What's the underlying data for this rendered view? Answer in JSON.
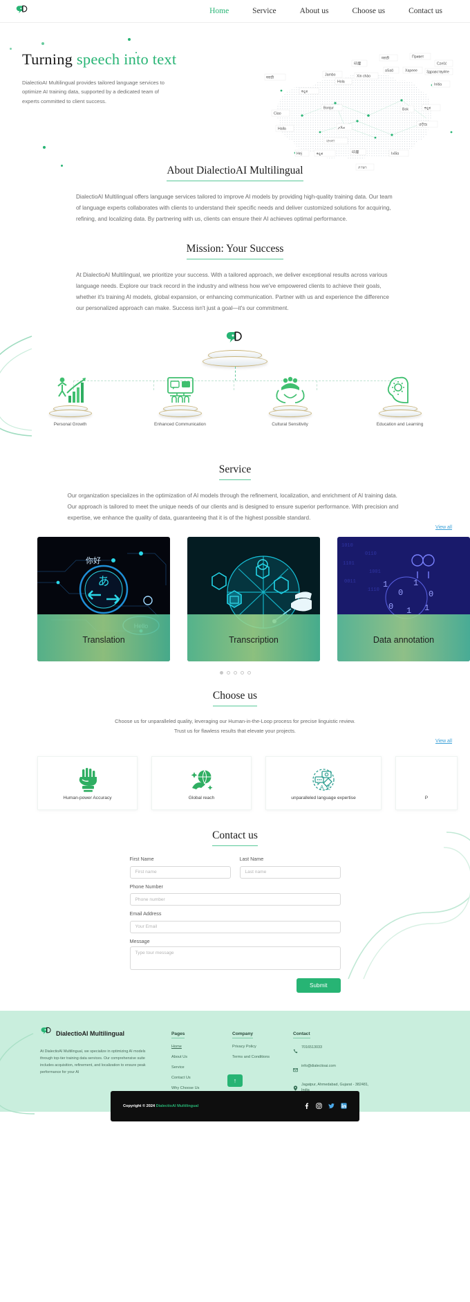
{
  "nav": {
    "brand": "DialectioAI",
    "links": [
      {
        "label": "Home",
        "active": true
      },
      {
        "label": "Service",
        "active": false
      },
      {
        "label": "About us",
        "active": false
      },
      {
        "label": "Choose us",
        "active": false
      },
      {
        "label": "Contact us",
        "active": false
      }
    ]
  },
  "hero": {
    "title_lead": "Turning ",
    "title_accent": "speech into text",
    "paragraph": "DialectioAI Multilingual provides tailored language services to optimize AI training data, supported by a dedicated team of experts committed to client success.",
    "map_labels": [
      "Привет",
      "Czeŝć",
      "Здравствуйте",
      "印度",
      "नमस्ते",
      "Hola",
      "aSaŭ",
      "Хареее",
      "Xin chào",
      "Jambo",
      "Initia",
      "Ciao",
      "Bonjur",
      "Bok",
      "ಕನ್ನಡ",
      "Halla",
      "سلام",
      "ଓଡ଼ିଆ",
      "বাংলা",
      "Hej",
      "ಕನ್ನಡ",
      "Ινδία",
      "ภาษา"
    ]
  },
  "about": {
    "title": "About DialectioAI Multilingual",
    "paragraph": "DialectioAI Multilingual offers language services tailored to improve AI models by providing high-quality training data. Our team of language experts collaborates with clients to understand their specific needs and deliver customized solutions for acquiring, refining, and localizing data. By partnering with us, clients can ensure their AI achieves optimal performance."
  },
  "mission": {
    "title": "Mission: Your Success",
    "paragraph": "At DialectioAI Multilingual, we prioritize your success. With a tailored approach, we deliver exceptional results across various language needs. Explore our track record in the industry and witness how we've empowered clients to achieve their goals, whether it's training AI models, global expansion, or enhancing communication. Partner with us and experience the difference our personalized approach can make. Success isn't just a goal—it's our commitment.",
    "pillars": [
      {
        "label": "Personal Growth",
        "icon": "growth-chart-icon"
      },
      {
        "label": "Enhanced Communication",
        "icon": "communication-icon"
      },
      {
        "label": "Cultural Sensitivity",
        "icon": "hands-people-icon"
      },
      {
        "label": "Education and Learning",
        "icon": "brain-gear-icon"
      }
    ]
  },
  "service": {
    "title": "Service",
    "paragraph": "Our organization specializes in the optimization of AI models through the refinement, localization, and enrichment of AI training data. Our approach is tailored to meet the unique needs of our clients and is designed to ensure superior performance. With precision and expertise, we enhance the quality of data, guaranteeing that it is of the highest possible standard.",
    "view_all": "View all",
    "cards": [
      {
        "title": "Translation"
      },
      {
        "title": "Transcription"
      },
      {
        "title": "Data annotation"
      }
    ],
    "carousel_dots": 5,
    "carousel_active": 0
  },
  "choose": {
    "title": "Choose us",
    "paragraph": "Choose us for unparalleled quality, leveraging our Human-in-the-Loop process for precise linguistic review. Trust us for flawless results that elevate your projects.",
    "view_all": "View all",
    "features": [
      {
        "label": "Human-power Accuracy",
        "icon": "raised-fist-icon"
      },
      {
        "label": "Global reach",
        "icon": "globe-hand-icon"
      },
      {
        "label": "unparalleled language expertise",
        "icon": "language-exchange-icon"
      },
      {
        "label": "P",
        "icon": "partial-card-icon"
      }
    ]
  },
  "contact": {
    "title": "Contact us",
    "fields": {
      "first_name": {
        "label": "First Name",
        "placeholder": "First name",
        "value": ""
      },
      "last_name": {
        "label": "Last Name",
        "placeholder": "Last name",
        "value": ""
      },
      "phone": {
        "label": "Phone Number",
        "placeholder": "Phone number",
        "value": ""
      },
      "email": {
        "label": "Email Address",
        "placeholder": "Your Email",
        "value": ""
      },
      "message": {
        "label": "Message",
        "placeholder": "Type tour message",
        "value": ""
      }
    },
    "submit": "Submit"
  },
  "footer": {
    "brand_name": "DialectioAI Multilingual",
    "about": "At DialectioAI Multilingual, we specialize in optimizing AI models through top-tier training data services. Our comprehensive suite includes acquisition, refinement, and localization to ensure peak performance for your AI",
    "pages": {
      "heading": "Pages",
      "items": [
        "Home",
        "About Us",
        "Service",
        "Contact Us",
        "Why Choose Us"
      ]
    },
    "company": {
      "heading": "Company",
      "items": [
        "Privacy Policy",
        "Terms and Conditions"
      ]
    },
    "contact": {
      "heading": "Contact",
      "phone": "7016513033",
      "email": "info@dialectioai.com",
      "address": "Jagatpur, Ahmedabad, Gujarat - 382481, India"
    },
    "copyright_lead": "Copyright © 2024 ",
    "copyright_brand": "DialectioAI Multilingual",
    "socials": [
      "facebook-icon",
      "instagram-icon",
      "twitter-icon",
      "linkedin-icon"
    ],
    "scroll_top": "↑"
  },
  "colors": {
    "accent": "#27b474",
    "accent_light": "#58c898",
    "footer_bg": "#c9eedd",
    "link_blue": "#3aa0d8"
  }
}
